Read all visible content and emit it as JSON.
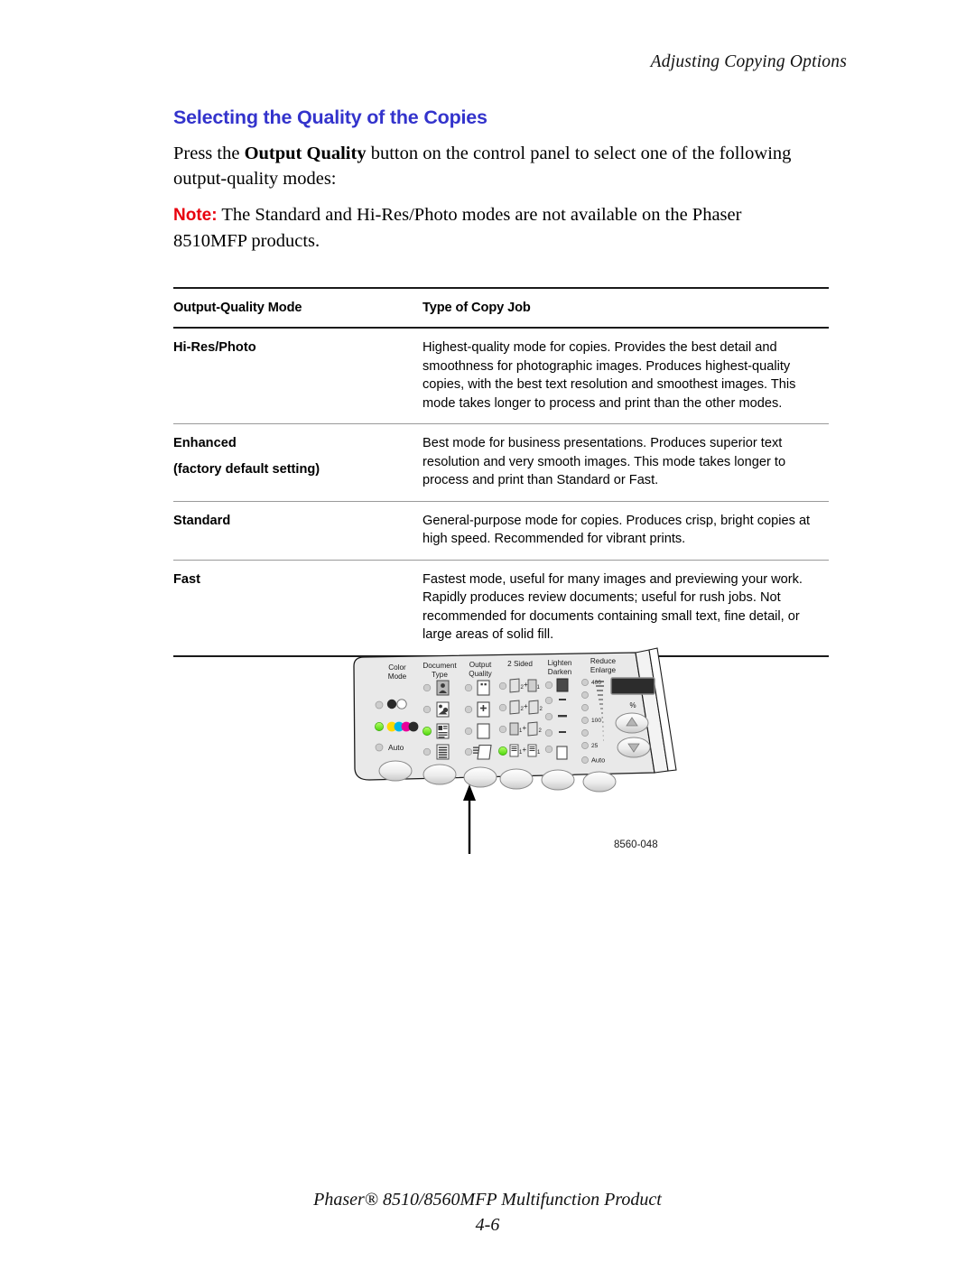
{
  "running_head": "Adjusting Copying Options",
  "section": {
    "heading": "Selecting the Quality of the Copies",
    "heading_color": "#3333cc",
    "intro_before": "Press the ",
    "intro_bold": "Output Quality",
    "intro_after": " button on the control panel to select one of the following output-quality modes:",
    "note_label": "Note:",
    "note_label_color": "#e8000d",
    "note_text": " The Standard and Hi-Res/Photo modes are not available on the Phaser 8510MFP products."
  },
  "table": {
    "headers": [
      "Output-Quality Mode",
      "Type of Copy Job"
    ],
    "rows": [
      {
        "mode": "Hi-Res/Photo",
        "mode_sub": "",
        "description": "Highest-quality mode for copies. Provides the best detail and smoothness for photographic images. Produces highest-quality copies, with the best text resolution and smoothest images. This mode takes longer to process and print than the other modes."
      },
      {
        "mode": "Enhanced",
        "mode_sub": "(factory default setting)",
        "description": "Best mode for business presentations. Produces superior text resolution and very smooth images. This mode takes longer to process and print than Standard or Fast."
      },
      {
        "mode": "Standard",
        "mode_sub": "",
        "description": "General-purpose mode for copies. Produces crisp, bright copies at high speed. Recommended for vibrant prints."
      },
      {
        "mode": "Fast",
        "mode_sub": "",
        "description": "Fastest mode, useful for many images and previewing your work. Rapidly produces review documents; useful for rush jobs. Not recommended for documents containing small text, fine detail, or large areas of solid fill."
      }
    ]
  },
  "figure": {
    "id_label": "8560-048",
    "panel_groups": [
      {
        "line1": "Color",
        "line2": "Mode"
      },
      {
        "line1": "Document",
        "line2": "Type"
      },
      {
        "line1": "Output",
        "line2": "Quality"
      },
      {
        "line1": "2 Sided",
        "line2": ""
      },
      {
        "line1": "Lighten",
        "line2": "Darken"
      },
      {
        "line1": "Reduce",
        "line2": "Enlarge"
      }
    ],
    "color_mode_auto_label": "Auto",
    "reduce_enlarge_scale": [
      "400",
      "100",
      "25"
    ],
    "reduce_enlarge_auto_label": "Auto",
    "percent_label": "%",
    "lit_led_color": "#66ee22"
  },
  "footer": {
    "product_line": "Phaser® 8510/8560MFP Multifunction Product",
    "page_number": "4-6"
  }
}
